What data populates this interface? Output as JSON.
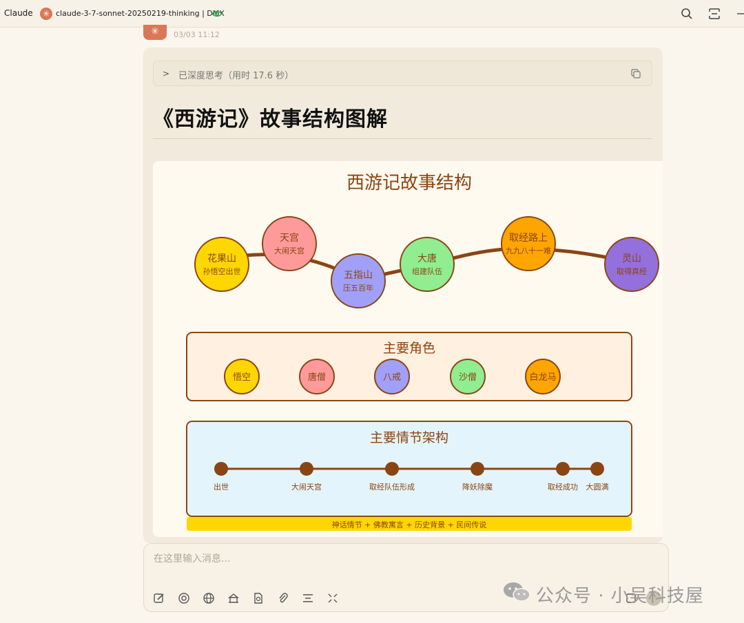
{
  "titlebar": {
    "app_name": "Claude",
    "model": "claude-3-7-sonnet-20250219-thinking | DMX"
  },
  "message": {
    "timestamp": "03/03 11:12",
    "thinking_label": "已深度思考（用时 17.6 秒）",
    "title": "《西游记》故事结构图解"
  },
  "diagram": {
    "title": "西游记故事结构",
    "journey": [
      {
        "name": "花果山",
        "sub": "孙悟空出世",
        "color": "#ffd700"
      },
      {
        "name": "天宫",
        "sub": "大闹天宫",
        "color": "#ff9a9a"
      },
      {
        "name": "五指山",
        "sub": "压五百年",
        "color": "#a0a0f8"
      },
      {
        "name": "大唐",
        "sub": "组建队伍",
        "color": "#90ee90"
      },
      {
        "name": "取经路上",
        "sub": "九九八十一难",
        "color": "#ffa500"
      },
      {
        "name": "灵山",
        "sub": "取得真经",
        "color": "#9370db"
      }
    ],
    "roles_title": "主要角色",
    "roles": [
      {
        "name": "悟空",
        "color": "#ffd700"
      },
      {
        "name": "唐僧",
        "color": "#ff9a9a"
      },
      {
        "name": "八戒",
        "color": "#a0a0f8"
      },
      {
        "name": "沙僧",
        "color": "#90ee90"
      },
      {
        "name": "白龙马",
        "color": "#ffa500"
      }
    ],
    "plot_title": "主要情节架构",
    "plot_points": [
      "出世",
      "大闹天宫",
      "取经队伍形成",
      "降妖除魔",
      "取经成功",
      "大圆满"
    ],
    "footer": "神话情节 + 佛教寓言 + 历史背景 + 民间传说"
  },
  "input": {
    "placeholder": "在这里输入消息..."
  },
  "watermark": "公众号 · 小吴科技屋",
  "colors": {
    "accent": "#d97757",
    "path_brown": "#8b4513",
    "roles_bg": "#fff0e0",
    "plot_bg": "#e3f4fc",
    "footer_bg": "#ffd700"
  }
}
